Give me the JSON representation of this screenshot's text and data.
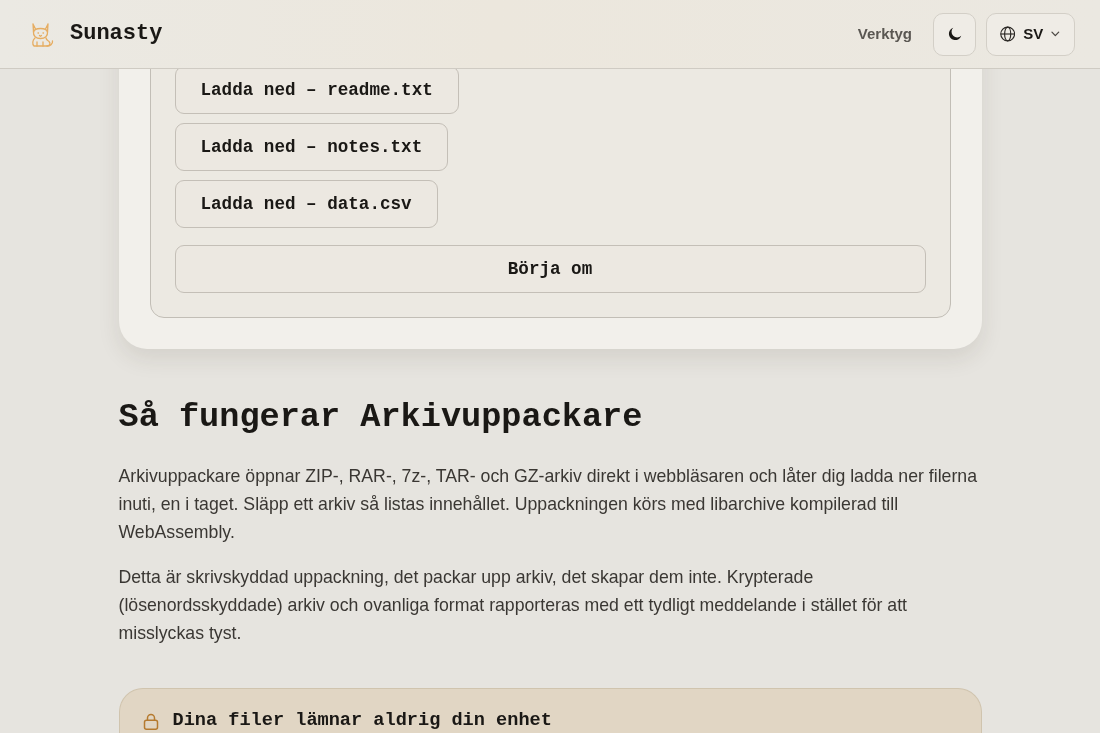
{
  "header": {
    "brand": "Sunasty",
    "nav_link": "Verktyg",
    "language": "SV"
  },
  "results": {
    "downloads": [
      "Ladda ned – readme.txt",
      "Ladda ned – notes.txt",
      "Ladda ned – data.csv"
    ],
    "restart_button": "Börja om"
  },
  "about": {
    "heading": "Så fungerar Arkivuppackare",
    "paragraphs": [
      "Arkivuppackare öppnar ZIP-, RAR-, 7z-, TAR- och GZ-arkiv direkt i webbläsaren och låter dig ladda ner filerna inuti, en i taget. Släpp ett arkiv så listas innehållet. Uppackningen körs med libarchive kompilerad till WebAssembly.",
      "Detta är skrivskyddad uppackning, det packar upp arkiv, det skapar dem inte. Krypterade (lösenordsskyddade) arkiv och ovanliga format rapporteras med ett tydligt meddelande i stället för att misslyckas tyst."
    ]
  },
  "privacy_notice": {
    "title": "Dina filer lämnar aldrig din enhet"
  }
}
